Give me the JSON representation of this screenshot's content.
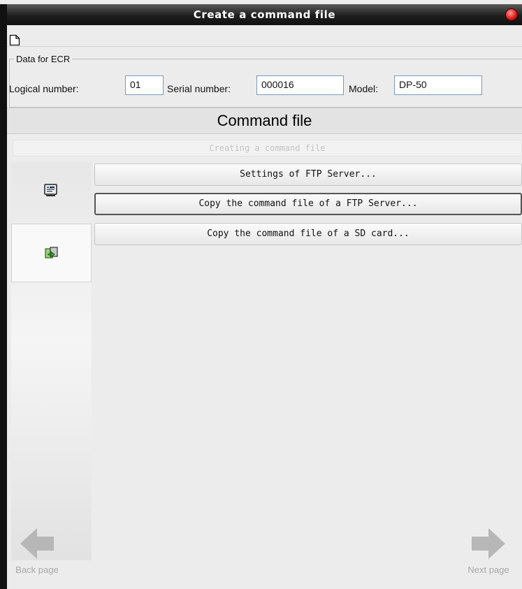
{
  "window": {
    "title": "Create a command file"
  },
  "ecr": {
    "legend": "Data for ECR",
    "logical_label": "Logical number:",
    "logical_value": "01",
    "serial_label": "Serial number:",
    "serial_value": "000016",
    "model_label": "Model:",
    "model_value": "DP-50"
  },
  "section": {
    "title": "Command file",
    "subtitle": "Creating a command file"
  },
  "buttons": [
    {
      "label": "Settings of FTP Server..."
    },
    {
      "label": "Copy the command file of a FTP Server..."
    },
    {
      "label": "Copy the command file of a SD card..."
    }
  ],
  "sidebar": {
    "items": [
      {
        "icon": "monitor-icon"
      },
      {
        "icon": "copy-files-icon"
      }
    ]
  },
  "nav": {
    "back": "Back page",
    "next": "Next page"
  },
  "colors": {
    "titlebar": "#1e1e1e",
    "close": "#e02020",
    "panel": "#ececec"
  }
}
